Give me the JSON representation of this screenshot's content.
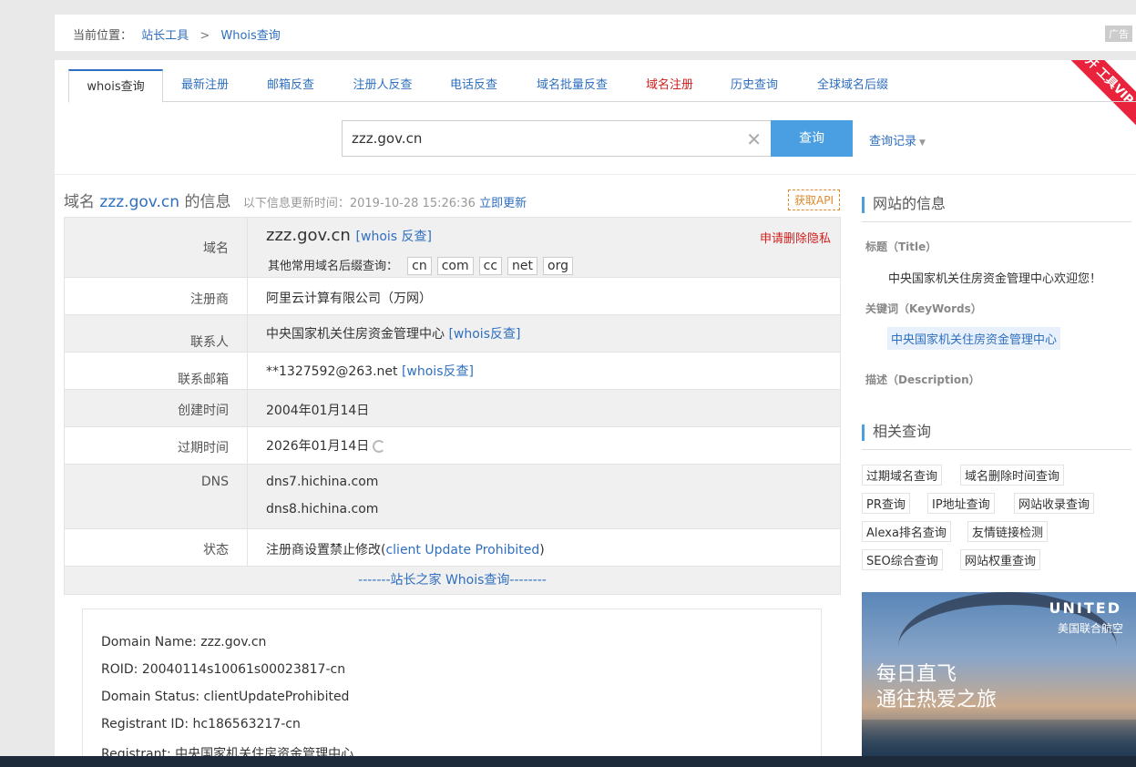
{
  "breadcrumb": {
    "prefix": "当前位置：",
    "item1": "站长工具",
    "sep": ">",
    "item2": "Whois查询"
  },
  "ad_tag": "广告",
  "ribbon": "开 工具VIP",
  "tabs": [
    {
      "label": "whois查询"
    },
    {
      "label": "最新注册"
    },
    {
      "label": "邮箱反查"
    },
    {
      "label": "注册人反查"
    },
    {
      "label": "电话反查"
    },
    {
      "label": "域名批量反查"
    },
    {
      "label": "域名注册"
    },
    {
      "label": "历史查询"
    },
    {
      "label": "全球域名后缀"
    }
  ],
  "search": {
    "value": "zzz.gov.cn",
    "button": "查询",
    "history": "查询记录"
  },
  "info": {
    "prefix": "域名",
    "domain": "zzz.gov.cn",
    "suffix": "的信息",
    "updated_label": "以下信息更新时间：2019-10-28 15:26:36",
    "update_link": "立即更新",
    "api_button": "获取API"
  },
  "rows": {
    "domain": {
      "label": "域名",
      "value": "zzz.gov.cn",
      "reverse": "[whois 反查]",
      "privacy": "申请删除隐私",
      "other_label": "其他常用域名后缀查询：",
      "tlds": [
        "cn",
        "com",
        "cc",
        "net",
        "org"
      ]
    },
    "registrar": {
      "label": "注册商",
      "value": "阿里云计算有限公司（万网）"
    },
    "contact": {
      "label": "联系人",
      "value": "中央国家机关住房资金管理中心",
      "reverse": "[whois反查]"
    },
    "email": {
      "label": "联系邮箱",
      "value": "**1327592@263.net",
      "reverse": "[whois反查]"
    },
    "created": {
      "label": "创建时间",
      "value": "2004年01月14日"
    },
    "expires": {
      "label": "过期时间",
      "value": "2026年01月14日"
    },
    "dns": {
      "label": "DNS",
      "values": [
        "dns7.hichina.com",
        "dns8.hichina.com"
      ]
    },
    "status": {
      "label": "状态",
      "value_prefix": "注册商设置禁止修改(",
      "value_link": "client Update Prohibited",
      "value_suffix": ")"
    }
  },
  "whois_header": "-------站长之家 Whois查询--------",
  "raw_lines": [
    "Domain Name: zzz.gov.cn",
    "ROID: 20040114s10061s00023817-cn",
    "Domain Status: clientUpdateProhibited",
    "Registrant ID: hc186563217-cn",
    "Registrant: 中央国家机关住房资金管理中心"
  ],
  "sidebar": {
    "site_info_title": "网站的信息",
    "title_label": "标题（Title）",
    "title_value": "中央国家机关住房资金管理中心欢迎您！",
    "keywords_label": "关键词（KeyWords）",
    "keywords_value": "中央国家机关住房资金管理中心",
    "desc_label": "描述（Description）",
    "related_title": "相关查询",
    "related": [
      "过期域名查询",
      "域名删除时间查询",
      "PR查询",
      "IP地址查询",
      "网站收录查询",
      "Alexa排名查询",
      "友情链接检测",
      "SEO综合查询",
      "网站权重查询"
    ]
  },
  "ad": {
    "brand": "UNITED",
    "brand_sub": "美国联合航空",
    "line1": "每日直飞",
    "line2": "通往热爱之旅"
  }
}
